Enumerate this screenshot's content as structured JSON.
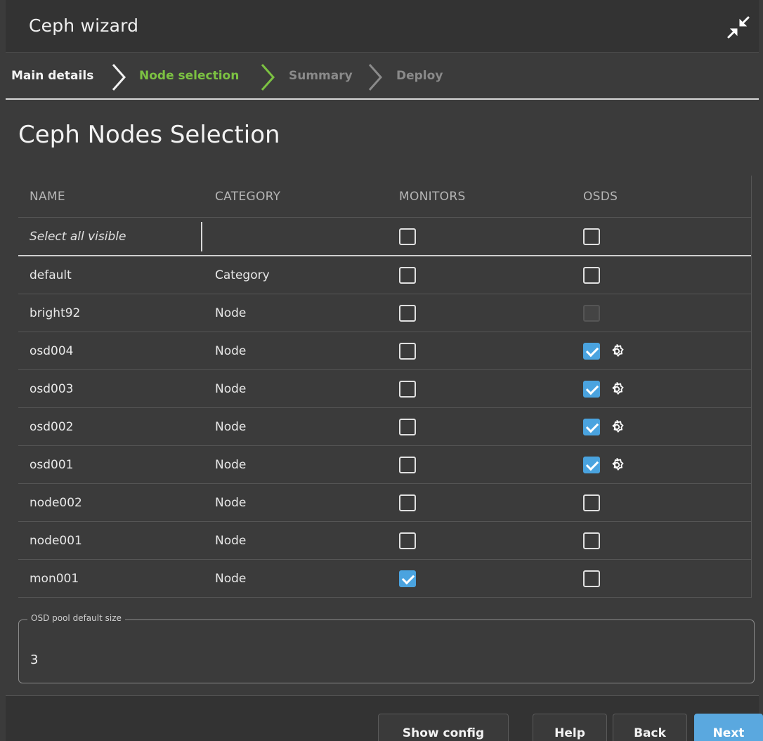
{
  "window": {
    "title": "Ceph wizard"
  },
  "steps": [
    {
      "label": "Main details",
      "state": "done"
    },
    {
      "label": "Node selection",
      "state": "active"
    },
    {
      "label": "Summary",
      "state": "pending"
    },
    {
      "label": "Deploy",
      "state": "pending"
    }
  ],
  "page": {
    "heading": "Ceph Nodes Selection"
  },
  "table": {
    "columns": [
      "NAME",
      "CATEGORY",
      "MONITORS",
      "OSDS"
    ],
    "select_all_label": "Select all visible",
    "rows": [
      {
        "name": "default",
        "category": "Category",
        "monitors": false,
        "osds": false,
        "osds_disabled": false,
        "osds_config": false
      },
      {
        "name": "bright92",
        "category": "Node",
        "monitors": false,
        "osds": false,
        "osds_disabled": true,
        "osds_config": false
      },
      {
        "name": "osd004",
        "category": "Node",
        "monitors": false,
        "osds": true,
        "osds_disabled": false,
        "osds_config": true
      },
      {
        "name": "osd003",
        "category": "Node",
        "monitors": false,
        "osds": true,
        "osds_disabled": false,
        "osds_config": true
      },
      {
        "name": "osd002",
        "category": "Node",
        "monitors": false,
        "osds": true,
        "osds_disabled": false,
        "osds_config": true
      },
      {
        "name": "osd001",
        "category": "Node",
        "monitors": false,
        "osds": true,
        "osds_disabled": false,
        "osds_config": true
      },
      {
        "name": "node002",
        "category": "Node",
        "monitors": false,
        "osds": false,
        "osds_disabled": false,
        "osds_config": false
      },
      {
        "name": "node001",
        "category": "Node",
        "monitors": false,
        "osds": false,
        "osds_disabled": false,
        "osds_config": false
      },
      {
        "name": "mon001",
        "category": "Node",
        "monitors": true,
        "osds": false,
        "osds_disabled": false,
        "osds_config": false
      }
    ]
  },
  "pool_size": {
    "legend": "OSD pool default size",
    "value": "3"
  },
  "footer": {
    "show_config_label": "Show config",
    "help_label": "Help",
    "back_label": "Back",
    "next_label": "Next"
  },
  "icons": {
    "collapse": "collapse-arrows-icon",
    "osd_config": "gear-icon",
    "step_separator": "chevron-right-icon"
  },
  "colors": {
    "active_step": "#7cc242",
    "checkbox_checked": "#4aa3df",
    "primary_button": "#5aa8df",
    "background": "#3b3b3b"
  }
}
